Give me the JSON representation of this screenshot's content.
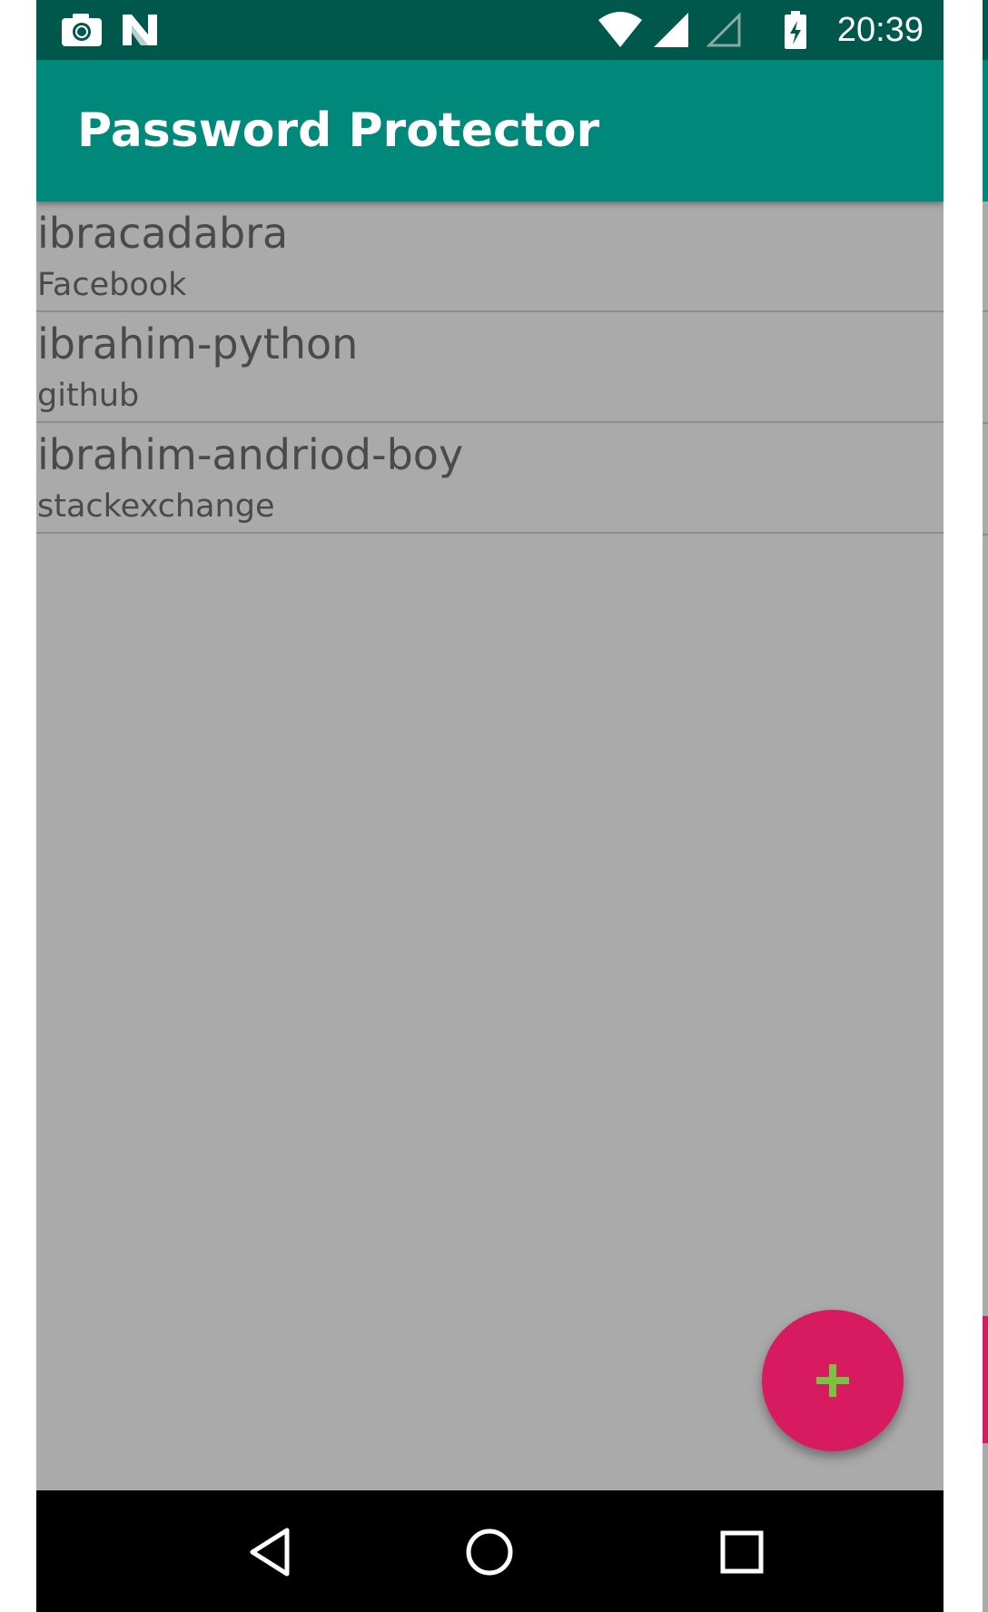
{
  "status_bar": {
    "time": "20:39",
    "icons": [
      "camera-icon",
      "n-icon",
      "wifi-icon",
      "signal-full-icon",
      "signal-empty-icon",
      "battery-charging-icon"
    ]
  },
  "app_bar": {
    "title": "Password Protector"
  },
  "list": {
    "items": [
      {
        "title": "ibracadabra",
        "subtitle": "Facebook"
      },
      {
        "title": "ibrahim-python",
        "subtitle": "github"
      },
      {
        "title": "ibrahim-andriod-boy",
        "subtitle": "stackexchange"
      }
    ]
  },
  "fab": {
    "icon": "plus-icon",
    "background": "#d81b60",
    "icon_color": "#7cc142"
  },
  "nav_bar": {
    "buttons": [
      "back-icon",
      "home-icon",
      "recents-icon"
    ]
  },
  "colors": {
    "status_bar": "#00574c",
    "app_bar": "#00887a",
    "scrim_background": "#aaaaaa",
    "text": "#4a4a4a"
  }
}
